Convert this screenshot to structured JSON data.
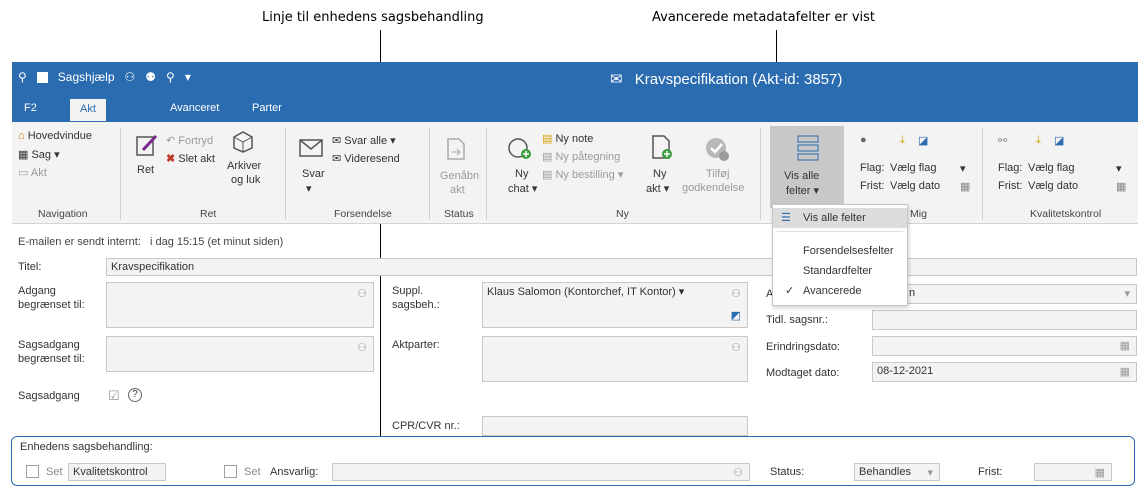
{
  "callouts": {
    "left": "Linje til enhedens sagsbehandling",
    "right": "Avancerede metadatafelter er vist"
  },
  "titlebar": {
    "qat_label": "Sagshjælp",
    "title": "Kravspecifikation (Akt-id: 3857)"
  },
  "tabs": [
    "F2",
    "Akt",
    "Avanceret",
    "Parter"
  ],
  "ribbon": {
    "navigation": {
      "hovedvindue": "Hovedvindue",
      "sag": "Sag ▾",
      "akt": "Akt",
      "label": "Navigation"
    },
    "ret": {
      "ret": "Ret",
      "fortryd": "Fortryd",
      "slet_akt": "Slet akt",
      "arkiver_1": "Arkiver",
      "arkiver_2": "og luk",
      "label": "Ret"
    },
    "forsendelse": {
      "svar": "Svar",
      "svar_arrow": "▾",
      "svar_alle": "Svar alle ▾",
      "videresend": "Videresend",
      "label": "Forsendelse"
    },
    "status": {
      "genaabn_1": "Genåbn",
      "genaabn_2": "akt",
      "label": "Status"
    },
    "ny": {
      "ny_chat_1": "Ny",
      "ny_chat_2": "chat ▾",
      "ny_note": "Ny note",
      "ny_paategning": "Ny påtegning",
      "ny_bestilling": "Ny bestilling ▾",
      "ny_akt_1": "Ny",
      "ny_akt_2": "akt ▾",
      "tilfoej_1": "Tilføj",
      "tilfoej_2": "godkendelse",
      "label": "Ny"
    },
    "vis": {
      "vis_alle_1": "Vis alle",
      "vis_alle_2": "felter ▾"
    },
    "mig": {
      "flag_label": "Flag:",
      "flag_value": "Vælg flag",
      "frist_label": "Frist:",
      "frist_value": "Vælg dato",
      "label": "Mig"
    },
    "kvalitet": {
      "flag_label": "Flag:",
      "flag_value": "Vælg flag",
      "frist_label": "Frist:",
      "frist_value": "Vælg dato",
      "label": "Kvalitetskontrol"
    }
  },
  "dropdown": {
    "vis_alle": "Vis alle felter",
    "forsendelse": "Forsendelsesfelter",
    "standard": "Standardfelter",
    "avancerede": "Avancerede",
    "check": "✓"
  },
  "status_line": {
    "text": "E-mailen er sendt internt:",
    "time": "i dag 15:15 (et minut siden)"
  },
  "form": {
    "titel_label": "Titel:",
    "titel_value": "Kravspecifikation",
    "adgang_1": "Adgang",
    "adgang_2": "begrænset til:",
    "sagsadgang_1": "Sagsadgang",
    "sagsadgang_2": "begrænset til:",
    "sagsadgang": "Sagsadgang",
    "help": "?",
    "suppl_1": "Suppl.",
    "suppl_2": "sagsbeh.:",
    "suppl_value": "Klaus Salomon (Kontorchef, IT Kontor) ▾",
    "aktparter": "Aktparter:",
    "cpr": "CPR/CVR nr.:",
    "right_top_label": "A",
    "right_top_value": "n",
    "tidl_sagsnr": "Tidl. sagsnr.:",
    "erindringsdato": "Erindringsdato:",
    "modtaget_dato": "Modtaget dato:",
    "modtaget_value": "08-12-2021"
  },
  "section": {
    "title": "Enhedens sagsbehandling:",
    "set1": "Set",
    "kvalitet": "Kvalitetskontrol",
    "set2": "Set",
    "ansvarlig": "Ansvarlig:",
    "status_label": "Status:",
    "status_value": "Behandles",
    "frist": "Frist:"
  }
}
